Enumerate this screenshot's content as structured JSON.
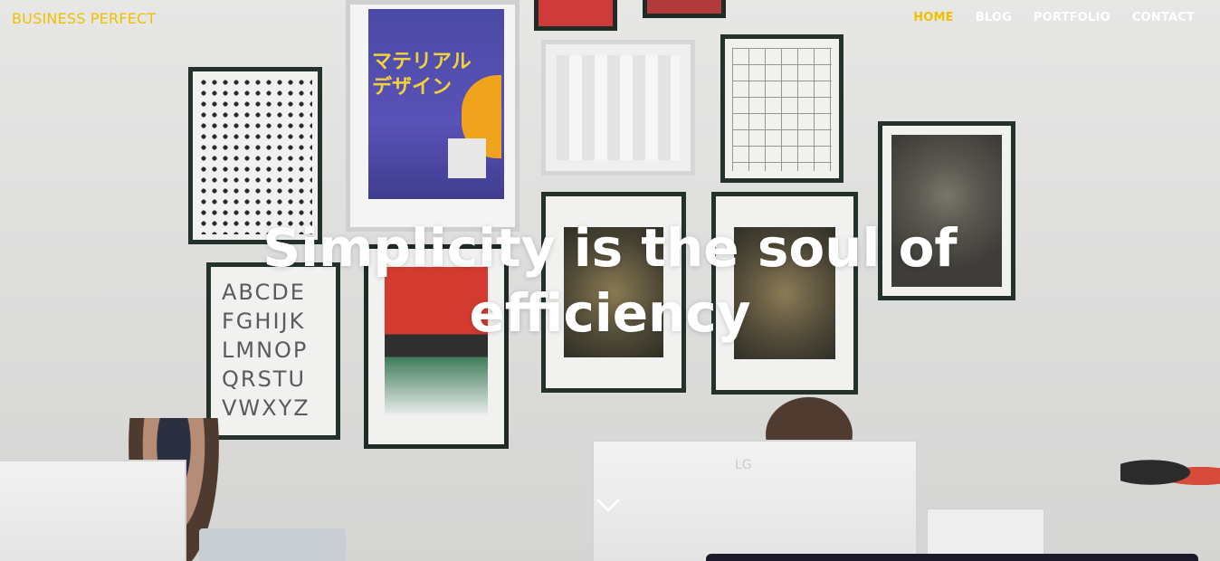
{
  "header": {
    "brand": "BUSINESS PERFECT",
    "nav": [
      {
        "label": "HOME",
        "active": true
      },
      {
        "label": "BLOG",
        "active": false
      },
      {
        "label": "PORTFOLIO",
        "active": false
      },
      {
        "label": "CONTACT",
        "active": false
      }
    ]
  },
  "hero": {
    "headline_line1": "Simplicity is the soul of",
    "headline_line2": "efficiency",
    "scroll_icon": "chevron-down-icon",
    "background_description": "office wall with framed posters"
  },
  "colors": {
    "accent": "#f0c000",
    "nav_text": "#ffffff",
    "headline": "#ffffff"
  },
  "poster_text": {
    "alphabet": "ABCDE FGHIJK LMNOP QRSTU VWXYZ",
    "japanese": "マテリアル デザイン",
    "monitor_brand": "LG"
  }
}
